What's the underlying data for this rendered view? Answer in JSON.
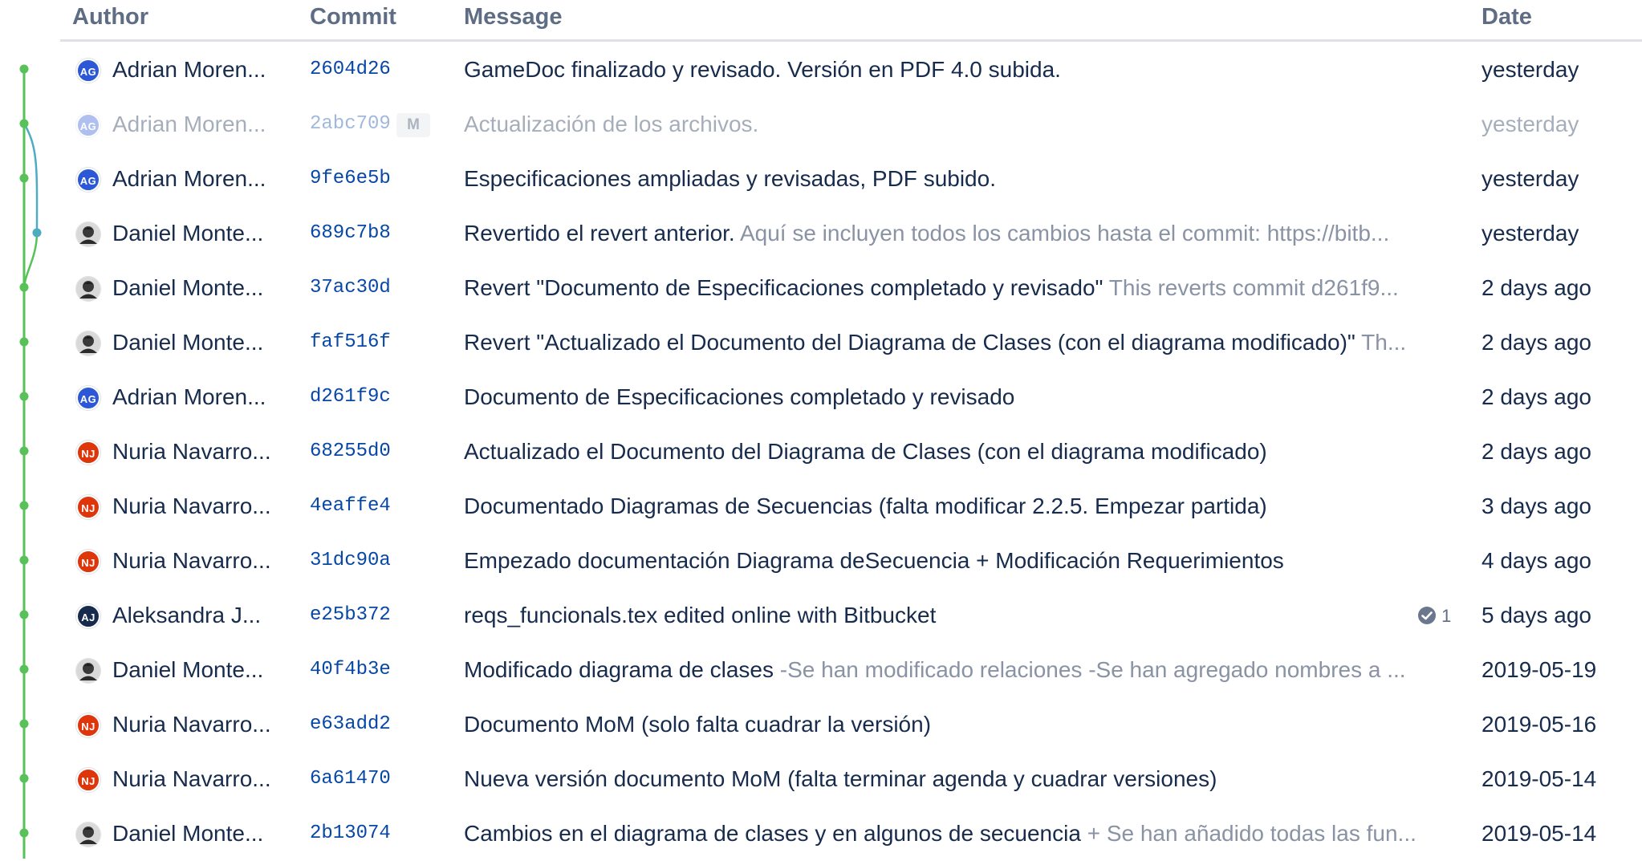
{
  "columns": {
    "author": "Author",
    "commit": "Commit",
    "message": "Message",
    "date": "Date"
  },
  "colors": {
    "graph_main": "#57c257",
    "graph_branch": "#4dabc2",
    "commit_hash": "#0747a6"
  },
  "commits": [
    {
      "avatar": "AG",
      "avatar_color": "#2c58d8",
      "author": "Adrian Moren...",
      "hash": "2604d26",
      "message": "GameDoc finalizado y revisado. Versión en PDF 4.0 subida.",
      "detail": "",
      "date": "yesterday"
    },
    {
      "avatar": "AG",
      "avatar_color": "#2c58d8",
      "author": "Adrian Moren...",
      "hash": "2abc709",
      "badge": "M",
      "message": "Actualización de los archivos.",
      "detail": "",
      "date": "yesterday",
      "muted": true
    },
    {
      "avatar": "AG",
      "avatar_color": "#2c58d8",
      "author": "Adrian Moren...",
      "hash": "9fe6e5b",
      "message": "Especificaciones ampliadas y revisadas, PDF subido.",
      "detail": "",
      "date": "yesterday"
    },
    {
      "avatar": "photo",
      "author": "Daniel Monte...",
      "hash": "689c7b8",
      "message": "Revertido el revert anterior.",
      "detail": "Aquí se incluyen todos los cambios hasta el commit: https://bitb...",
      "date": "yesterday"
    },
    {
      "avatar": "photo",
      "author": "Daniel Monte...",
      "hash": "37ac30d",
      "message": "Revert \"Documento de Especificaciones completado y revisado\"",
      "detail": "This reverts commit d261f9...",
      "date": "2 days ago"
    },
    {
      "avatar": "photo",
      "author": "Daniel Monte...",
      "hash": "faf516f",
      "message": "Revert \"Actualizado el Documento del Diagrama de Clases (con el diagrama modificado)\"",
      "detail": "Th...",
      "date": "2 days ago"
    },
    {
      "avatar": "AG",
      "avatar_color": "#2c58d8",
      "author": "Adrian Moren...",
      "hash": "d261f9c",
      "message": "Documento de Especificaciones completado y revisado",
      "detail": "",
      "date": "2 days ago"
    },
    {
      "avatar": "NJ",
      "avatar_color": "#de350b",
      "author": "Nuria Navarro...",
      "hash": "68255d0",
      "message": "Actualizado el Documento del Diagrama de Clases (con el diagrama modificado)",
      "detail": "",
      "date": "2 days ago"
    },
    {
      "avatar": "NJ",
      "avatar_color": "#de350b",
      "author": "Nuria Navarro...",
      "hash": "4eaffe4",
      "message": "Documentado Diagramas de Secuencias (falta modificar 2.2.5. Empezar partida)",
      "detail": "",
      "date": "3 days ago"
    },
    {
      "avatar": "NJ",
      "avatar_color": "#de350b",
      "author": "Nuria Navarro...",
      "hash": "31dc90a",
      "message": "Empezado documentación Diagrama deSecuencia + Modificación Requerimientos",
      "detail": "",
      "date": "4 days ago"
    },
    {
      "avatar": "AJ",
      "avatar_color": "#172b4d",
      "author": "Aleksandra J...",
      "hash": "e25b372",
      "message": "reqs_funcionals.tex edited online with Bitbucket",
      "detail": "",
      "build_count": "1",
      "date": "5 days ago"
    },
    {
      "avatar": "photo",
      "author": "Daniel Monte...",
      "hash": "40f4b3e",
      "message": "Modificado diagrama de clases",
      "detail": "-Se han modificado relaciones -Se han agregado nombres a ...",
      "date": "2019-05-19"
    },
    {
      "avatar": "NJ",
      "avatar_color": "#de350b",
      "author": "Nuria Navarro...",
      "hash": "e63add2",
      "message": "Documento MoM (solo falta cuadrar la versión)",
      "detail": "",
      "date": "2019-05-16"
    },
    {
      "avatar": "NJ",
      "avatar_color": "#de350b",
      "author": "Nuria Navarro...",
      "hash": "6a61470",
      "message": "Nueva versión documento MoM (falta terminar agenda y cuadrar versiones)",
      "detail": "",
      "date": "2019-05-14"
    },
    {
      "avatar": "photo",
      "author": "Daniel Monte...",
      "hash": "2b13074",
      "message": "Cambios en el diagrama de clases y en algunos de secuencia",
      "detail": "+ Se han añadido todas las fun...",
      "date": "2019-05-14"
    }
  ]
}
